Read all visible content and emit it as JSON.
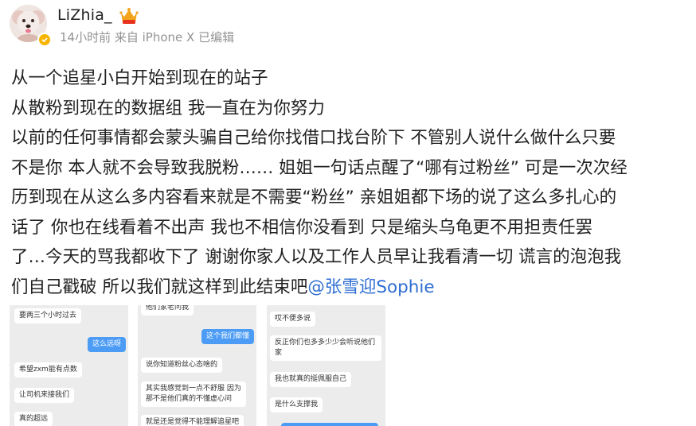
{
  "user": {
    "name": "LiZhia_",
    "meta": "14小时前 来自 iPhone X 已编辑"
  },
  "colors": {
    "mention": "#2e6ed2",
    "verified": "#f7b500",
    "my_bubble": "#4c9cf6"
  },
  "post": {
    "lines": [
      "从一个追星小白开始到现在的站子",
      "从散粉到现在的数据组 我一直在为你努力",
      "以前的任何事情都会蒙头骗自己给你找借口找台阶下 不管别人说什么做什么只要",
      "不是你 本人就不会导致我脱粉…… 姐姐一句话点醒了“哪有过粉丝” 可是一次次经",
      "历到现在从这么多内容看来就是不需要“粉丝” 亲姐姐都下场的说了这么多扎心的",
      "话了 你也在线看着不出声 我也不相信你没看到 只是缩头乌龟更不用担责任罢",
      "了…今天的骂我都收下了 谢谢你家人以及工作人员早让我看清一切 谎言的泡泡我"
    ],
    "last_line_prefix": "们自己戳破 所以我们就这样到此结束吧",
    "mention": "@张雪迎Sophie"
  },
  "screenshots": [
    {
      "messages": [
        {
          "text": "要两三个小时过去",
          "me": false
        },
        {
          "text": "这么远呀",
          "me": true
        },
        {
          "text": "希望zxm能有点数",
          "me": false
        },
        {
          "text": "让司机来接我们",
          "me": false
        },
        {
          "text": "真的超远",
          "me": false
        }
      ]
    },
    {
      "messages": [
        {
          "text": "他们家老问我",
          "me": false
        },
        {
          "text": "这个我们都懂",
          "me": true
        },
        {
          "text": "说你知道粉丝心态啥的",
          "me": false
        },
        {
          "text": "其实我感觉到一点不舒服 因为那不是他们真的不懂虚心问",
          "me": false
        },
        {
          "text": "就是还是觉得不能理解追星吧",
          "me": false
        }
      ]
    },
    {
      "messages": [
        {
          "text": "哎不便多说",
          "me": false
        },
        {
          "text": "反正你们也多多少少会听说他们家",
          "me": false
        },
        {
          "text": "我也就真的挺佩服自己",
          "me": false
        },
        {
          "text": "是什么支撑我",
          "me": false
        }
      ]
    }
  ]
}
